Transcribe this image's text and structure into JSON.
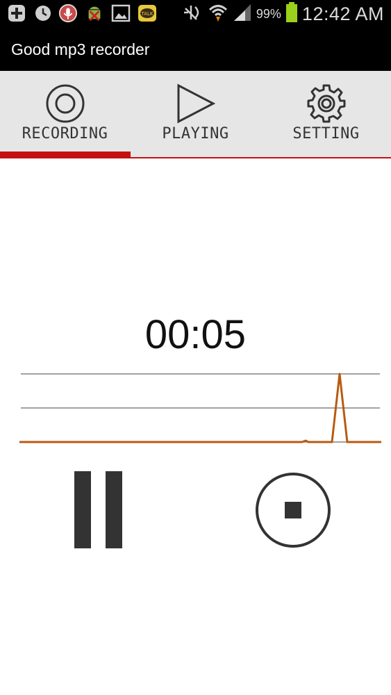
{
  "status_bar": {
    "icons": [
      "add-icon",
      "alarm-icon",
      "mic-icon",
      "android-icon",
      "gallery-icon",
      "kakaotalk-icon",
      "mute-icon",
      "wifi-icon",
      "signal-icon",
      "battery-icon"
    ],
    "kakao_text": "TALK",
    "battery_percent": "99%",
    "time": "12:42 AM"
  },
  "app_bar": {
    "title": "Good mp3 recorder"
  },
  "tabs": [
    {
      "label": "RECORDING",
      "icon": "record-icon",
      "selected": true
    },
    {
      "label": "PLAYING",
      "icon": "play-icon",
      "selected": false
    },
    {
      "label": "SETTING",
      "icon": "gear-icon",
      "selected": false
    }
  ],
  "recorder": {
    "elapsed": "00:05"
  },
  "controls": {
    "pause_icon": "pause-icon",
    "stop_icon": "stop-icon"
  },
  "colors": {
    "accent": "#c41010",
    "waveform": "#b85a10",
    "tab_bg": "#e6e6e6",
    "bar_bg": "#000000"
  }
}
